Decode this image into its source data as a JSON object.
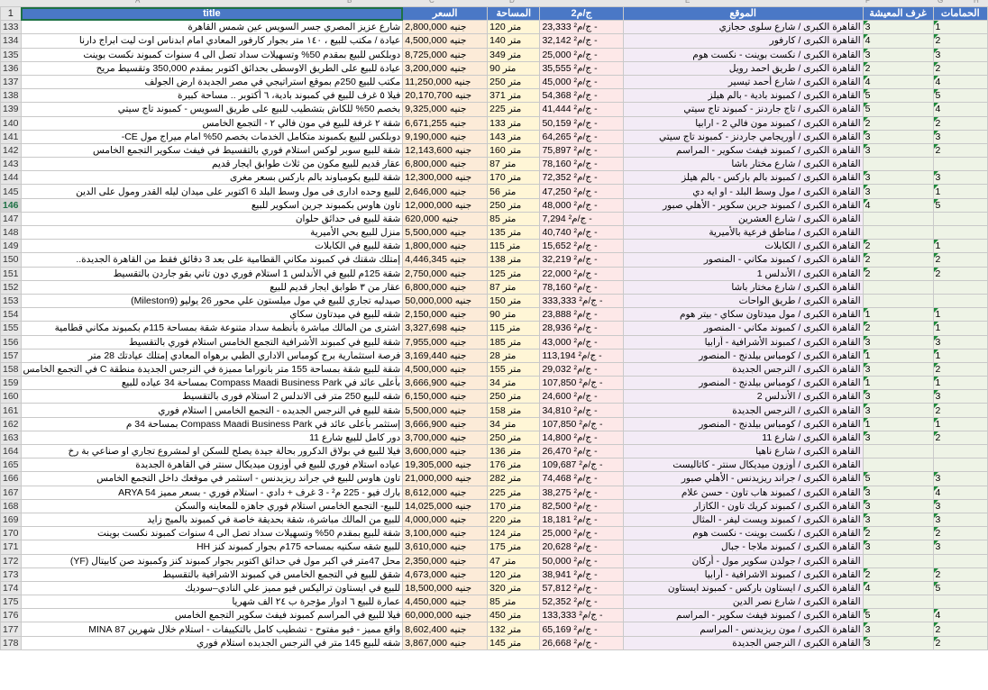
{
  "column_letters": [
    "A",
    "B",
    "C",
    "D",
    "E",
    "F",
    "G",
    "H"
  ],
  "headers": {
    "row_number": "1",
    "title": "title",
    "price": "السعر",
    "area": "المساحة",
    "price_per_m": "ج/م2",
    "location": "الموقع",
    "rooms": "غرف المعيشة",
    "baths": "الحمامات"
  },
  "rows": [
    {
      "n": "133",
      "title": "شارع عزيز المصري جسر السويس عين شمس القاهرة",
      "price": "جنيه 2,800,000",
      "area": "متر 120",
      "ppm": "ج/م² 23,333 -",
      "loc": "القاهرة الكبرى / شارع سلوى حجازي",
      "rooms": "3",
      "baths": "1"
    },
    {
      "n": "134",
      "title": "عيادة / مكتب للبيع ، ١٤٠ متر بجوار كارفور المعادي امام ابدناس اوت ليت ابراج دارنا",
      "price": "جنيه 4,500,000",
      "area": "متر 140",
      "ppm": "ج/م² 32,142 -",
      "loc": "القاهرة الكبرى / كارفور",
      "rooms": "4",
      "baths": "2"
    },
    {
      "n": "135",
      "title": "دوبلكس للبيع بمقدم 50% وتسهيلات سداد تصل الى 4 سنوات كمبوند نكست بوينت",
      "price": "جنيه 8,725,000",
      "area": "متر 349",
      "ppm": "ج/م² 25,000 -",
      "loc": "القاهرة الكبرى / نكست بوينت - نكست هوم",
      "rooms": "3",
      "baths": "3"
    },
    {
      "n": "136",
      "title": "عيادة للبيع على الطريق الاوسطى بحدائق اكتوبر بمقدم 350,000 وتقسيط مريح",
      "price": "جنيه 3,200,000",
      "area": "متر 90",
      "ppm": "ج/م² 35,555 -",
      "loc": "القاهرة الكبرى / طريق احمد رويل",
      "rooms": "2",
      "baths": "2"
    },
    {
      "n": "137",
      "title": "مكتب للبيع 250م بموقع استراتيجي في مصر الجديدة ارض الجولف",
      "price": "جنيه 11,250,000",
      "area": "متر 250",
      "ppm": "ج/م² 45,000 -",
      "loc": "القاهرة الكبرى / شارع أحمد تيسير",
      "rooms": "4",
      "baths": "4"
    },
    {
      "n": "138",
      "title": "فيلا ٥ غرف للبيع في كمبوند بادية، ٦ أكتوبر .. مساحة كبيرة",
      "price": "جنيه 20,170,700",
      "area": "متر 371",
      "ppm": "ج/م² 54,368 -",
      "loc": "القاهرة الكبرى / كمبوند بادية - بالم هيلز",
      "rooms": "5",
      "baths": "5"
    },
    {
      "n": "139",
      "title": "بخصم 50% للكاش بتشطيب للبيع على طريق السويس - كمبوند تاج سيتي",
      "price": "جنيه 9,325,000",
      "area": "متر 225",
      "ppm": "ج/م² 41,444 -",
      "loc": "القاهرة الكبرى / تاج جاردنز - كمبوند تاج سيتي",
      "rooms": "5",
      "baths": "4"
    },
    {
      "n": "140",
      "title": "شقة ٢ غرفة للبيع في مون فالي ٢ - التجمع الخامس",
      "price": "جنيه 6,671,255",
      "area": "متر 133",
      "ppm": "ج/م² 50,159 -",
      "loc": "القاهرة الكبرى / كمبوند مون فالي 2 - ارابيا",
      "rooms": "2",
      "baths": "2"
    },
    {
      "n": "141",
      "title": "دوبلكس للبيع بكمبوند متكامل الخدمات بخصم 50% امام ميراج مول CE-",
      "price": "جنيه 9,190,000",
      "area": "متر 143",
      "ppm": "ج/م² 64,265 -",
      "loc": "القاهرة الكبرى / أوريجامي جاردنز - كمبوند تاج سيتي",
      "rooms": "3",
      "baths": "3"
    },
    {
      "n": "142",
      "title": "شقة للبيع سوبر لوكس استلام فوري بالتقسيط في فيفث سكوير التجمع الخامس",
      "price": "جنيه 12,143,600",
      "area": "متر 160",
      "ppm": "ج/م² 75,897 -",
      "loc": "القاهرة الكبرى / كمبوند فيفث سكوير - المراسم",
      "rooms": "3",
      "baths": "2"
    },
    {
      "n": "143",
      "title": "عقار قديم للبيع مكون من ثلاث طوابق ايجار قديم",
      "price": "جنيه 6,800,000",
      "area": "متر 87",
      "ppm": "ج/م² 78,160 -",
      "loc": "القاهرة الكبرى / شارع مختار باشا",
      "rooms": "",
      "baths": ""
    },
    {
      "n": "144",
      "title": "شقة للبيع بكومباوند بالم باركس بسعر مغرى",
      "price": "جنيه 12,300,000",
      "area": "متر 170",
      "ppm": "ج/م² 72,352 -",
      "loc": "القاهرة الكبرى / كمبوند بالم باركس - بالم هيلز",
      "rooms": "3",
      "baths": "3"
    },
    {
      "n": "145",
      "title": "للبيع وحده ادارى فى مول وسط البلد 6 اكتوبر على ميدان ليله القدر ومول على الدين",
      "price": "جنيه 2,646,000",
      "area": "متر 56",
      "ppm": "ج/م² 47,250 -",
      "loc": "القاهرة الكبرى / مول وسط البلد - او ايه دي",
      "rooms": "3",
      "baths": "1"
    },
    {
      "n": "146",
      "title": "تاون هاوس بكمبوند جرين اسكوير للبيع",
      "price": "جنيه 12,000,000",
      "area": "متر 250",
      "ppm": "ج/م² 48,000 -",
      "loc": "القاهرة الكبرى / كمبوند جرين سكوير - الأهلي صبور",
      "rooms": "4",
      "baths": "5"
    },
    {
      "n": "147",
      "title": "شقة للبيع فى حدائق حلوان",
      "price": "جنيه 620,000",
      "area": "متر 85",
      "ppm": "ج/م² 7,294 -",
      "loc": "القاهرة الكبرى / شارع العشرين",
      "rooms": "",
      "baths": ""
    },
    {
      "n": "148",
      "title": "منزل للبيع بحي الأميرية",
      "price": "جنيه 5,500,000",
      "area": "متر 135",
      "ppm": "ج/م² 40,740 -",
      "loc": "القاهرة الكبرى / مناطق فرعية بالأميرية",
      "rooms": "",
      "baths": ""
    },
    {
      "n": "149",
      "title": "شقة للبيع في الكابلات",
      "price": "جنيه 1,800,000",
      "area": "متر 115",
      "ppm": "ج/م² 15,652 -",
      "loc": "القاهرة الكبرى / الكابلات",
      "rooms": "2",
      "baths": "1"
    },
    {
      "n": "150",
      "title": "إمتلك شقتك في كمبوند مكاني القطامية على بعد 3 دقائق فقط من القاهرة الجديدة..",
      "price": "جنيه 4,446,345",
      "area": "متر 138",
      "ppm": "ج/م² 32,219 -",
      "loc": "القاهرة الكبرى / كمبوند مكاني - المنصور",
      "rooms": "2",
      "baths": "2"
    },
    {
      "n": "151",
      "title": "شقة 125م للبيع في الأندلس 1 استلام فوري دون تاني بقو جاردن بالتقسيط",
      "price": "جنيه 2,750,000",
      "area": "متر 125",
      "ppm": "ج/م² 22,000 -",
      "loc": "القاهرة الكبرى / الأندلس 1",
      "rooms": "2",
      "baths": "2"
    },
    {
      "n": "152",
      "title": "عقار من ٣ طوابق ايجار قديم للبيع",
      "price": "جنيه 6,800,000",
      "area": "متر 87",
      "ppm": "ج/م² 78,160 -",
      "loc": "القاهرة الكبرى / شارع مختار باشا",
      "rooms": "",
      "baths": ""
    },
    {
      "n": "153",
      "title": "صيدليه تجاري للبيع في مول ميلستون علي محور 26 يوليو (Mileston9)",
      "price": "جنيه 50,000,000",
      "area": "متر 150",
      "ppm": "ج/م² 333,333 -",
      "loc": "القاهرة الكبرى / طريق الواحات",
      "rooms": "",
      "baths": ""
    },
    {
      "n": "154",
      "title": "شقه للبيع في ميدتاون سكاي",
      "price": "جنيه 2,150,000",
      "area": "متر 90",
      "ppm": "ج/م² 23,888 -",
      "loc": "القاهرة الكبرى / مول ميدتاون سكاي - بيتر هوم",
      "rooms": "1",
      "baths": "1"
    },
    {
      "n": "155",
      "title": "اشترى من المالك مباشرة بأنظمة سداد متنوعة شقة بمساحة 115م بكمبوند مكاني قطامية",
      "price": "جنيه 3,327,698",
      "area": "متر 115",
      "ppm": "ج/م² 28,936 -",
      "loc": "القاهرة الكبرى / كمبوند مكاني - المنصور",
      "rooms": "2",
      "baths": "1"
    },
    {
      "n": "156",
      "title": "شقة للبيع في كمبوند الأشرافية التجمع الخامس استلام فوري بالتقسيط",
      "price": "جنيه 7,955,000",
      "area": "متر 185",
      "ppm": "ج/م² 43,000 -",
      "loc": "القاهرة الكبرى / كمبوند الأشرافية - أرابيا",
      "rooms": "3",
      "baths": "3"
    },
    {
      "n": "157",
      "title": "فرصة استثمارية برج كومباس الاداري الطبي برهواه المعادي إمتلك عيادتك 28 متر",
      "price": "جنيه 3,169,440",
      "area": "متر 28",
      "ppm": "ج/م² 113,194 -",
      "loc": "القاهرة الكبرى / كومباس بيلدنج - المنصور",
      "rooms": "1",
      "baths": "1"
    },
    {
      "n": "158",
      "title": "شقة للبيع شقة بمساحة 155 متر بانوراما مميزة في النرجس الجديدة منطقة C في التجمع الخامس",
      "price": "جنيه 4,500,000",
      "area": "متر 155",
      "ppm": "ج/م² 29,032 -",
      "loc": "القاهرة الكبرى / النرجس الجديدة",
      "rooms": "3",
      "baths": "2"
    },
    {
      "n": "159",
      "title": "بأعلى عائد في Compass Maadi Business Park بمساحة 34 عياده للبيع",
      "price": "جنيه 3,666,900",
      "area": "متر 34",
      "ppm": "ج/م² 107,850 -",
      "loc": "القاهرة الكبرى / كومباس بيلدنج - المنصور",
      "rooms": "1",
      "baths": "1"
    },
    {
      "n": "160",
      "title": "شقه للبيع 250 متر فى الاندلس 2 استلام فورى بالتقسيط",
      "price": "جنيه 6,150,000",
      "area": "متر 250",
      "ppm": "ج/م² 24,600 -",
      "loc": "القاهرة الكبرى / الأندلس 2",
      "rooms": "3",
      "baths": "3"
    },
    {
      "n": "161",
      "title": "شقة للبيع في النرجس الجديده - التجمع الخامس | استلام فوري",
      "price": "جنيه 5,500,000",
      "area": "متر 158",
      "ppm": "ج/م² 34,810 -",
      "loc": "القاهرة الكبرى / النرجس الجديدة",
      "rooms": "3",
      "baths": "2"
    },
    {
      "n": "162",
      "title": "إستثمر بأعلى عائد في Compass Maadi Business Park بمساحة 34 م",
      "price": "جنيه 3,666,900",
      "area": "متر 34",
      "ppm": "ج/م² 107,850 -",
      "loc": "القاهرة الكبرى / كومباس بيلدنج - المنصور",
      "rooms": "1",
      "baths": "1"
    },
    {
      "n": "163",
      "title": "دور كامل للبيع شارع 11",
      "price": "جنيه 3,700,000",
      "area": "متر 250",
      "ppm": "ج/م² 14,800 -",
      "loc": "القاهرة الكبرى / شارع 11",
      "rooms": "3",
      "baths": "2"
    },
    {
      "n": "164",
      "title": "فيلا للبيع في بولاق الدكرور بحالة جيدة يصلح للسكن او لمشروع تجاري او صناعي بة رخ",
      "price": "جنيه 3,600,000",
      "area": "متر 136",
      "ppm": "ج/م² 26,470 -",
      "loc": "القاهرة الكبرى / شارع ناهيا",
      "rooms": "",
      "baths": ""
    },
    {
      "n": "165",
      "title": "عياده استلام فوري للبيع في أوزون ميديكال سنتر في القاهرة الجديدة",
      "price": "جنيه 19,305,000",
      "area": "متر 176",
      "ppm": "ج/م² 109,687 -",
      "loc": "القاهرة الكبرى / أوزون ميديكال سنتر - كاتاليست",
      "rooms": "",
      "baths": ""
    },
    {
      "n": "166",
      "title": "تاون هاوس للبيع في جراند ريزيدنس - استثمر في موقعك داخل التجمع الخامس",
      "price": "جنيه 21,000,000",
      "area": "متر 282",
      "ppm": "ج/م² 74,468 -",
      "loc": "القاهرة الكبرى / جراند ريزيدنس - الأهلي صبور",
      "rooms": "5",
      "baths": "3"
    },
    {
      "n": "167",
      "title": "بارك فيو - 225 م² - 3 غرف + دادي - استلام فوري - بسعر مميز ARYA 54",
      "price": "جنيه 8,612,000",
      "area": "متر 225",
      "ppm": "ج/م² 38,275 -",
      "loc": "القاهرة الكبرى / كمبوند هاب تاون - حسن علام",
      "rooms": "3",
      "baths": "4"
    },
    {
      "n": "168",
      "title": "للبيع- التجمع الخامس استلام فوري جاهزه للمعاينه والسكن",
      "price": "جنيه 14,025,000",
      "area": "متر 170",
      "ppm": "ج/م² 82,500 -",
      "loc": "القاهرة الكبرى / كمبوند كريك تاون - الكازار",
      "rooms": "3",
      "baths": "3"
    },
    {
      "n": "169",
      "title": "للبيع من المالك مباشرة، شقة بحديقة خاصة في كمبوند بالميج زايد",
      "price": "جنيه 4,000,000",
      "area": "متر 220",
      "ppm": "ج/م² 18,181 -",
      "loc": "القاهرة الكبرى / كمبوند ويست ليفر - المثال",
      "rooms": "3",
      "baths": "3"
    },
    {
      "n": "170",
      "title": "شقة للبيع بمقدم 50% وتسهيلات سداد تصل الى 4 سنوات كمبوند نكست بوينت",
      "price": "جنيه 3,100,000",
      "area": "متر 124",
      "ppm": "ج/م² 25,000 -",
      "loc": "القاهرة الكبرى / نكست بوينت - نكست هوم",
      "rooms": "2",
      "baths": "2"
    },
    {
      "n": "171",
      "title": "للبيع شقه سكنيه بمساحه 175م بجوار كمبوند كنز HH",
      "price": "جنيه 3,610,000",
      "area": "متر 175",
      "ppm": "ج/م² 20,628 -",
      "loc": "القاهرة الكبرى / كمبوند ملاجا - جبال",
      "rooms": "3",
      "baths": "3"
    },
    {
      "n": "172",
      "title": "محل 47متر في اكبر مول في حدائق اكتوبر بجوار كمبوند كنز وكمبوند صن كابيتال (YF)",
      "price": "جنيه 2,350,000",
      "area": "متر 47",
      "ppm": "ج/م² 50,000 -",
      "loc": "القاهرة الكبرى / جولدن سكوير مول - أركان",
      "rooms": "",
      "baths": ""
    },
    {
      "n": "173",
      "title": "شقق للبيع في التجمع الخامس في كمبوند الاشرافية بالتقسيط",
      "price": "جنيه 4,673,000",
      "area": "متر 120",
      "ppm": "ج/م² 38,941 -",
      "loc": "القاهرة الكبرى / كمبوند الاشرافية - أرابيا",
      "rooms": "2",
      "baths": "2"
    },
    {
      "n": "174",
      "title": "للبيع في ايستاون تراليكس فيو مميز علي النادي–سوديك",
      "price": "جنيه 18,500,000",
      "area": "متر 320",
      "ppm": "ج/م² 57,812 -",
      "loc": "القاهرة الكبرى / ايستاون باركس - كمبوند ايستاون",
      "rooms": "4",
      "baths": "5"
    },
    {
      "n": "175",
      "title": "عمارة للبيع ٦ ادوار مؤجرة ب ٢٤ الف شهريا",
      "price": "جنيه 4,450,000",
      "area": "متر 85",
      "ppm": "ج/م² 52,352 -",
      "loc": "القاهرة الكبرى / شارع نصر الدين",
      "rooms": "",
      "baths": ""
    },
    {
      "n": "176",
      "title": "فيلا للبيع في المراسم كمبوند فيفث سكوير التجمع الخامس",
      "price": "جنيه 60,000,000",
      "area": "متر 450",
      "ppm": "ج/م² 133,333 -",
      "loc": "القاهرة الكبرى / كمبوند فيفث سكوير - المراسم",
      "rooms": "5",
      "baths": "4"
    },
    {
      "n": "177",
      "title": "واقع مميز - فيو مفتوح - تشطيب كامل بالتكييفات - استلام خلال شهرين 87 MINA",
      "price": "جنيه 8,602,400",
      "area": "متر 132",
      "ppm": "ج/م² 65,169 -",
      "loc": "القاهرة الكبرى / مون ريزيدنس - المراسم",
      "rooms": "3",
      "baths": "2"
    },
    {
      "n": "178",
      "title": "شقه للبيع 145 متر في النرجس الجديده استلام فوري",
      "price": "جنيه 3,867,000",
      "area": "متر 145",
      "ppm": "ج/م² 26,668 -",
      "loc": "القاهرة الكبرى / النرجس الجديدة",
      "rooms": "3",
      "baths": "2"
    }
  ]
}
